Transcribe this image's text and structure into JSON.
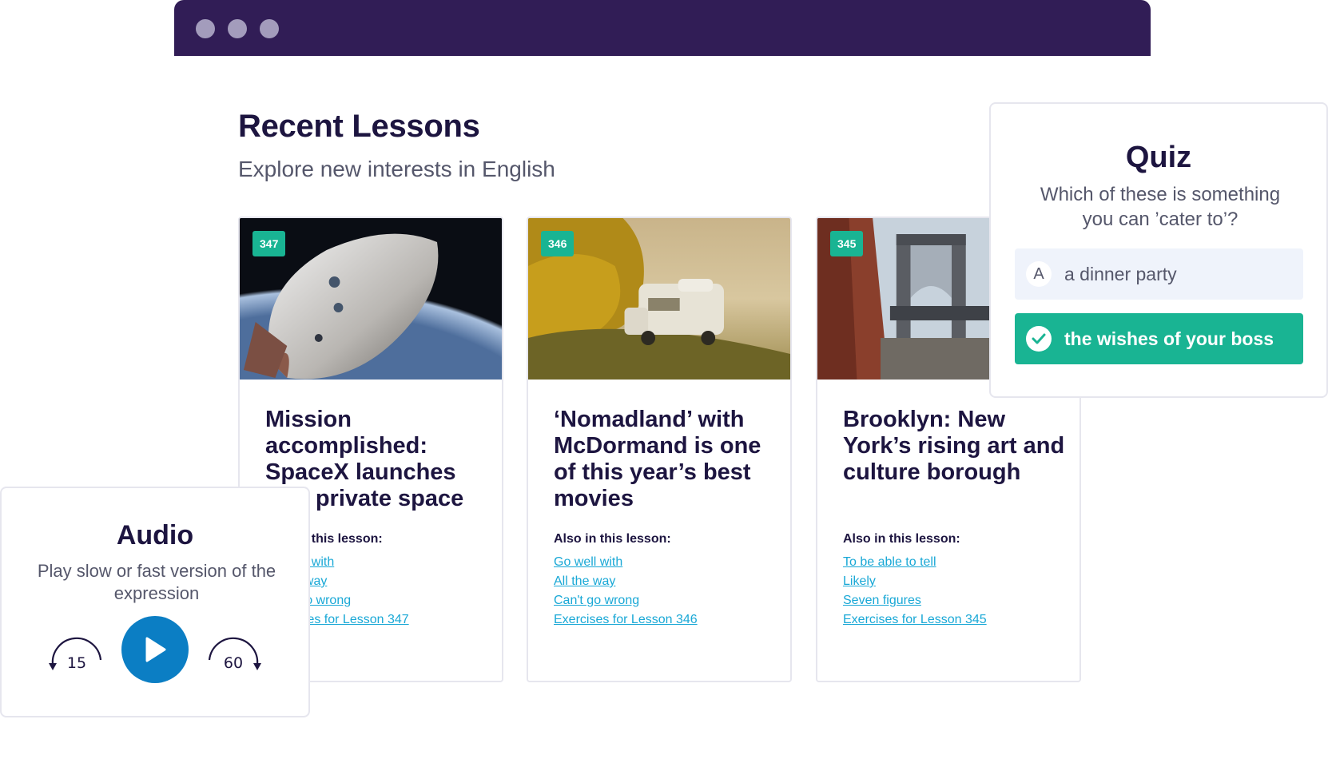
{
  "page": {
    "title": "Recent Lessons",
    "subtitle": "Explore new interests in English"
  },
  "lessons": [
    {
      "number": "347",
      "image": "spacecraft-orbit-image",
      "title": "Mission accomplished: SpaceX launches first private space",
      "also_label": "Also in this lesson:",
      "links": [
        "Go well with",
        "All the way",
        "Can't go wrong",
        "Exercises for Lesson 347"
      ]
    },
    {
      "number": "346",
      "image": "camper-van-coast-image",
      "title": "‘Nomadland’ with McDormand is one of this year’s best movies",
      "also_label": "Also in this lesson:",
      "links": [
        "Go well with",
        "All the way",
        "Can't go wrong",
        "Exercises for Lesson 346"
      ]
    },
    {
      "number": "345",
      "image": "brooklyn-bridge-image",
      "title": "Brooklyn: New York’s rising art and culture borough",
      "also_label": "Also in this lesson:",
      "links": [
        "To be able to tell",
        "Likely",
        "Seven figures",
        "Exercises for Lesson 345"
      ]
    }
  ],
  "quiz": {
    "title": "Quiz",
    "question": "Which of these is something you can ’cater to’?",
    "options": [
      {
        "letter": "A",
        "text": "a dinner party",
        "selected": false
      },
      {
        "letter": "",
        "text": "the wishes of your boss",
        "selected": true,
        "icon": "check-icon"
      }
    ]
  },
  "audio": {
    "title": "Audio",
    "description": "Play slow or fast version of the expression",
    "skip_back": "15",
    "skip_forward": "60",
    "play_icon": "play-icon"
  },
  "colors": {
    "titlebar": "#311d56",
    "accent_green": "#19b493",
    "play_blue": "#0b7ec4",
    "link": "#19a8d6",
    "heading": "#1d1540"
  }
}
